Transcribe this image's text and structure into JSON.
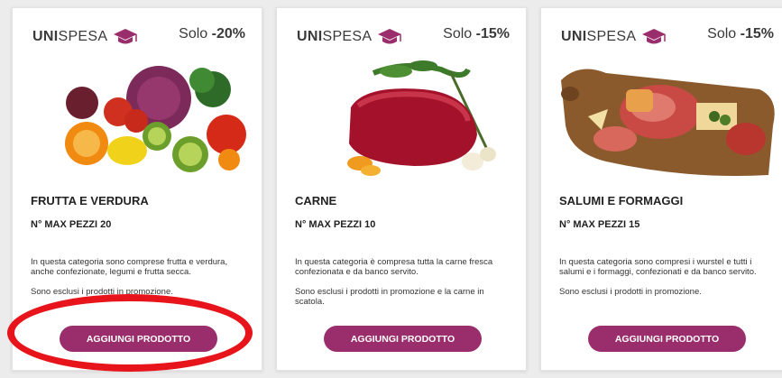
{
  "brand": {
    "uni": "UNI",
    "spesa": "SPESA",
    "icon": "graduation-cap-icon",
    "icon_color": "#9a2d6b"
  },
  "accent_color": "#9a2d6b",
  "highlight_color": "#e8141b",
  "cards": [
    {
      "discount_prefix": "Solo",
      "discount_value": "-20%",
      "image": "fruit-vegetables-image",
      "title": "FRUTTA E VERDURA",
      "max_pezzi": "N° MAX PEZZI 20",
      "desc_1": "In questa categoria sono comprese frutta e verdura, anche confezionate, legumi e frutta secca.",
      "desc_2": "Sono esclusi i prodotti in promozione.",
      "button": "AGGIUNGI PRODOTTO"
    },
    {
      "discount_prefix": "Solo",
      "discount_value": "-15%",
      "image": "meat-image",
      "title": "CARNE",
      "max_pezzi": "N° MAX PEZZI 10",
      "desc_1": "In questa categoria è compresa tutta la carne fresca confezionata e da banco servito.",
      "desc_2": "Sono esclusi i prodotti in promozione e la carne in scatola.",
      "button": "AGGIUNGI PRODOTTO"
    },
    {
      "discount_prefix": "Solo",
      "discount_value": "-15%",
      "image": "cured-meats-cheese-image",
      "title": "SALUMI E FORMAGGI",
      "max_pezzi": "N° MAX PEZZI 15",
      "desc_1": "In questa categoria sono compresi i wurstel e tutti i salumi e i formaggi, confezionati e da banco servito.",
      "desc_2": "Sono esclusi i prodotti in promozione.",
      "button": "AGGIUNGI PRODOTTO"
    }
  ]
}
